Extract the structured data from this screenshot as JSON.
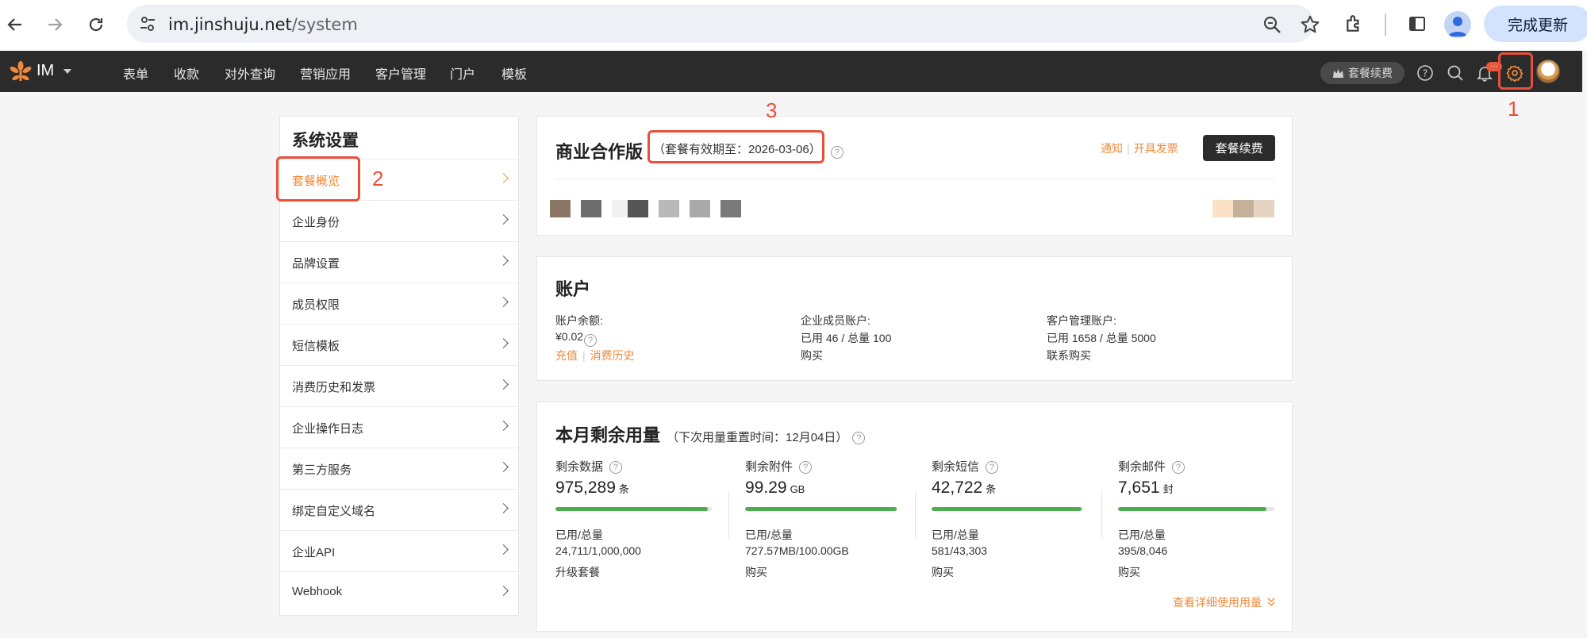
{
  "browser": {
    "url_host": "im.jinshuju.net",
    "url_path": "/system",
    "update_label": "完成更新"
  },
  "header": {
    "brand": "IM",
    "menu": [
      "表单",
      "收款",
      "对外查询",
      "营销应用",
      "客户管理",
      "门户",
      "模板"
    ],
    "renew_label": "套餐续费",
    "notification_badge": "···"
  },
  "annotations": [
    "1",
    "2",
    "3"
  ],
  "sidebar": {
    "title": "系统设置",
    "items": [
      {
        "label": "套餐概览",
        "active": true
      },
      {
        "label": "企业身份"
      },
      {
        "label": "品牌设置"
      },
      {
        "label": "成员权限"
      },
      {
        "label": "短信模板"
      },
      {
        "label": "消费历史和发票"
      },
      {
        "label": "企业操作日志"
      },
      {
        "label": "第三方服务"
      },
      {
        "label": "绑定自定义域名"
      },
      {
        "label": "企业API"
      },
      {
        "label": "Webhook"
      }
    ]
  },
  "plan": {
    "title": "商业合作版",
    "validity": "（套餐有效期至：2026-03-06）",
    "link_notify": "通知",
    "link_invoice": "开具发票",
    "renew_button": "套餐续费",
    "swatches": [
      "#8b7663",
      "#6e6e6e",
      "#f1f1f1",
      "#555555",
      "#b9b9b9",
      "#a9a9a9",
      "#7a7a7a"
    ],
    "swatches_right": [
      "#fbe1c6",
      "#c5b09c",
      "#e6d3c1"
    ]
  },
  "account": {
    "title": "账户",
    "balance_label": "账户余额:",
    "balance_value": "¥0.02",
    "recharge_link": "充值",
    "history_link": "消费历史",
    "members_label": "企业成员账户:",
    "members_value": "已用 46 / 总量 100",
    "members_link": "购买",
    "crm_label": "客户管理账户:",
    "crm_value": "已用 1658 / 总量 5000",
    "crm_link": "联系购买"
  },
  "usage": {
    "title": "本月剩余用量",
    "reset_note": "（下次用量重置时间：12月04日）",
    "used_total_label": "已用/总量",
    "detail_link": "查看详细使用用量",
    "items": [
      {
        "label": "剩余数据",
        "value": "975,289",
        "unit": "条",
        "used_total": "24,711/1,000,000",
        "link": "升级套餐",
        "remaining_fraction": 0.975
      },
      {
        "label": "剩余附件",
        "value": "99.29",
        "unit": "GB",
        "used_total": "727.57MB/100.00GB",
        "link": "购买",
        "remaining_fraction": 0.993
      },
      {
        "label": "剩余短信",
        "value": "42,722",
        "unit": "条",
        "used_total": "581/43,303",
        "link": "购买",
        "remaining_fraction": 0.987
      },
      {
        "label": "剩余邮件",
        "value": "7,651",
        "unit": "封",
        "used_total": "395/8,046",
        "link": "购买",
        "remaining_fraction": 0.951
      }
    ]
  }
}
